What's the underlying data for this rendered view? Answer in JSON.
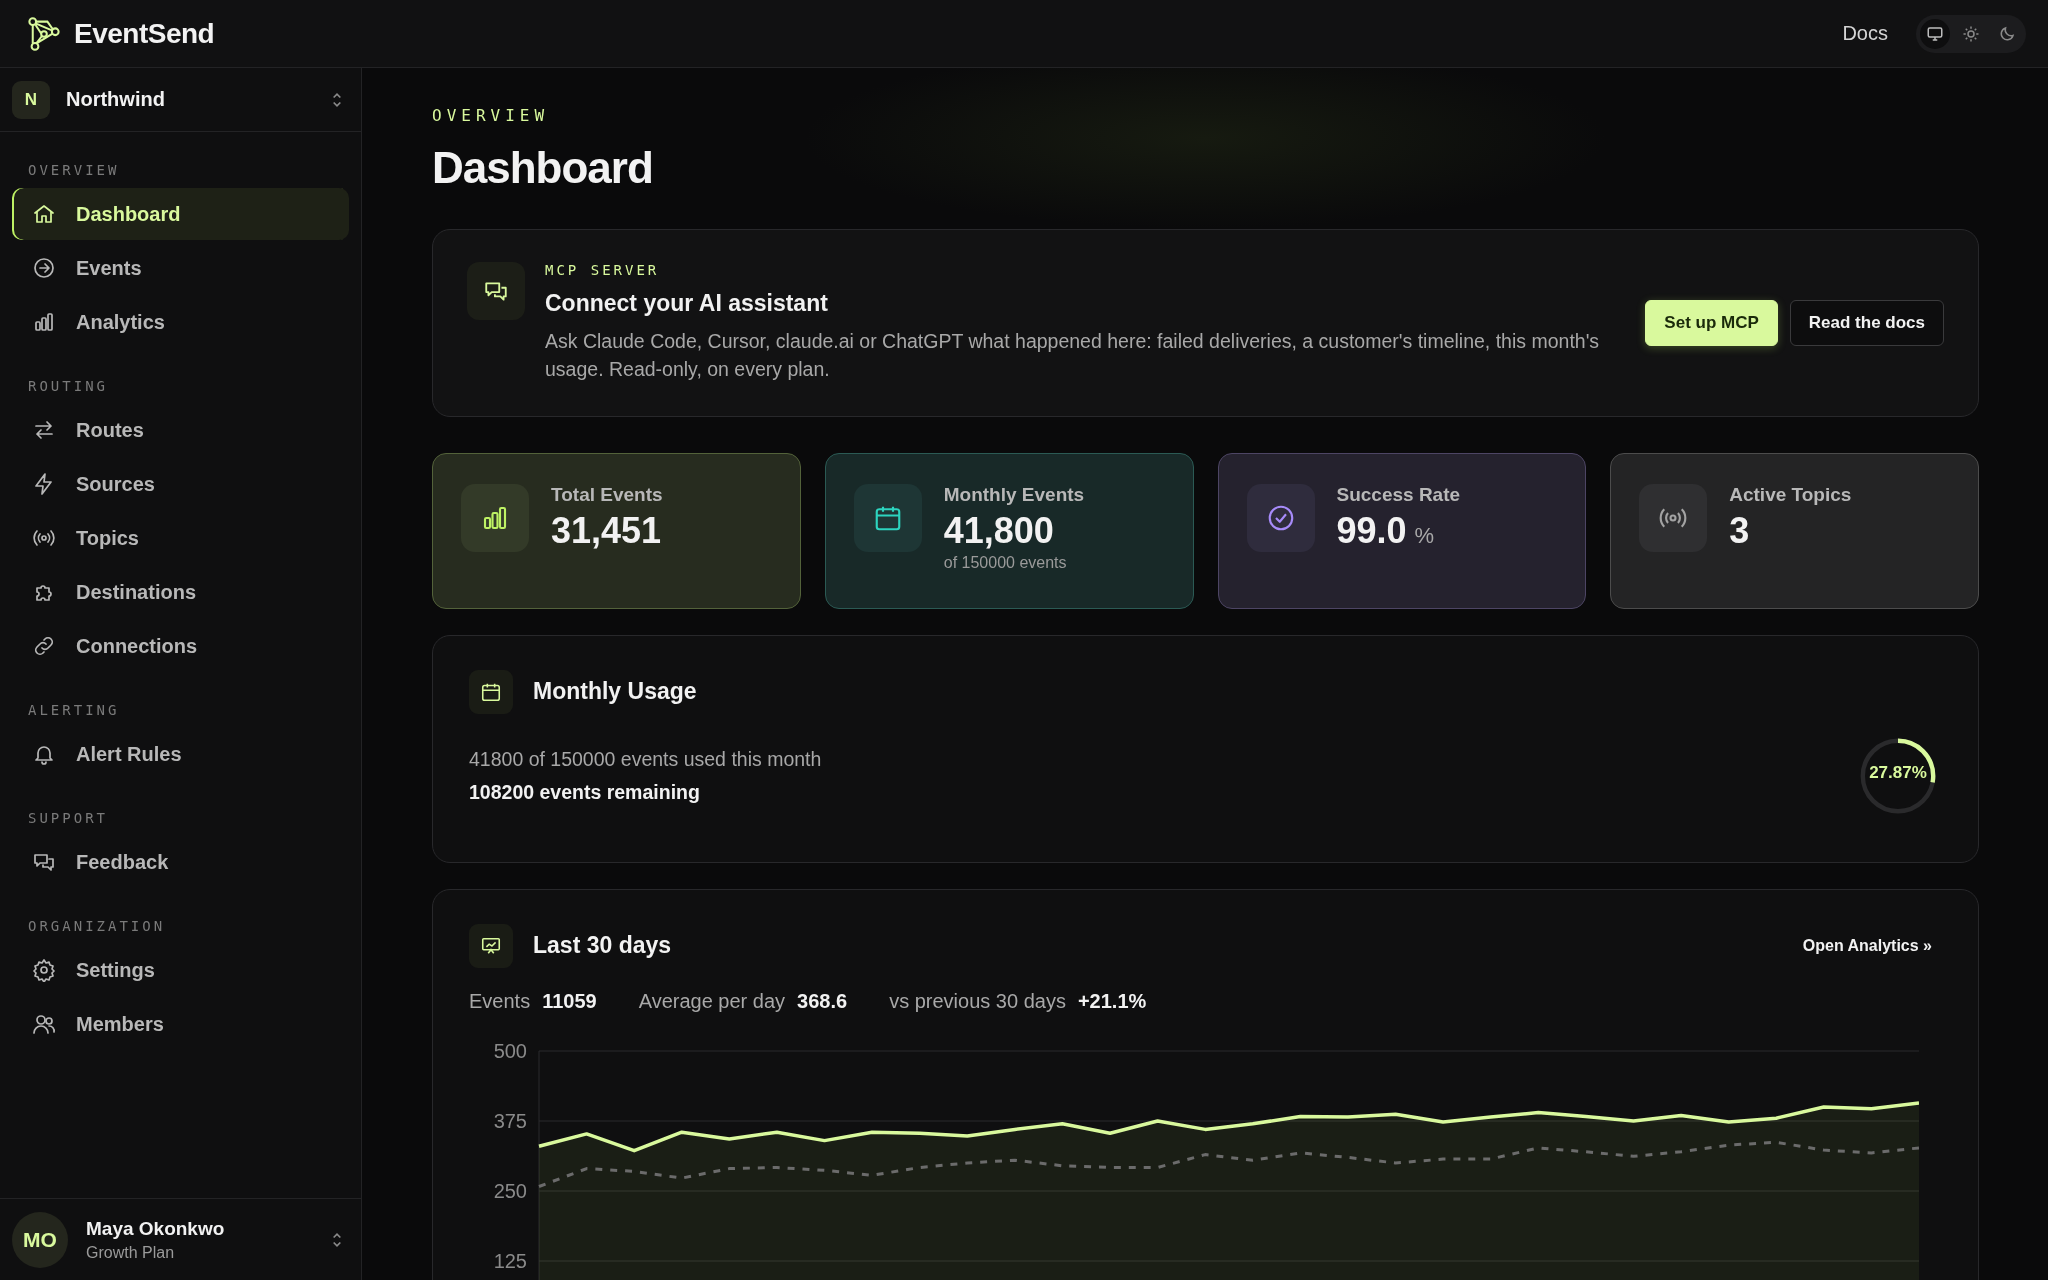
{
  "header": {
    "brand": "EventSend",
    "docs_link": "Docs",
    "theme_options": [
      {
        "kind": "system",
        "selected": true
      },
      {
        "kind": "light",
        "selected": false
      },
      {
        "kind": "dark",
        "selected": false
      }
    ]
  },
  "org_switcher": {
    "initial": "N",
    "name": "Northwind"
  },
  "sidebar": {
    "sections": [
      {
        "title": "OVERVIEW",
        "items": [
          {
            "label": "Dashboard",
            "selected": true
          },
          {
            "label": "Events",
            "selected": false
          },
          {
            "label": "Analytics",
            "selected": false
          }
        ]
      },
      {
        "title": "ROUTING",
        "items": [
          {
            "label": "Routes",
            "selected": false
          },
          {
            "label": "Sources",
            "selected": false
          },
          {
            "label": "Topics",
            "selected": false
          },
          {
            "label": "Destinations",
            "selected": false
          },
          {
            "label": "Connections",
            "selected": false
          }
        ]
      },
      {
        "title": "ALERTING",
        "items": [
          {
            "label": "Alert Rules",
            "selected": false
          }
        ]
      },
      {
        "title": "SUPPORT",
        "items": [
          {
            "label": "Feedback",
            "selected": false
          }
        ]
      },
      {
        "title": "ORGANIZATION",
        "items": [
          {
            "label": "Settings",
            "selected": false
          },
          {
            "label": "Members",
            "selected": false
          }
        ]
      }
    ]
  },
  "user": {
    "initials": "MO",
    "name": "Maya Okonkwo",
    "plan": "Growth Plan"
  },
  "page": {
    "eyebrow": "OVERVIEW",
    "title": "Dashboard"
  },
  "mcp_card": {
    "eyebrow": "MCP SERVER",
    "title": "Connect your AI assistant",
    "description": "Ask Claude Code, Cursor, claude.ai or ChatGPT what happened here: failed deliveries, a customer's timeline, this month's usage. Read-only, on every plan.",
    "buttons": [
      {
        "label": "Set up MCP",
        "kind": "primary"
      },
      {
        "label": "Read the docs",
        "kind": "secondary"
      }
    ]
  },
  "stats": [
    {
      "label": "Total Events",
      "value": "31,451",
      "color": "#bef264"
    },
    {
      "label": "Monthly Events",
      "value": "41,800",
      "sub": "of 150000 events",
      "color": "#2dd4bf"
    },
    {
      "label": "Success Rate",
      "value": "99.0",
      "unit": "%",
      "color": "#a78bfa"
    },
    {
      "label": "Active Topics",
      "value": "3",
      "color": "#a3a3a3"
    }
  ],
  "monthly_usage": {
    "title": "Monthly Usage",
    "used_text": "41800 of 150000 events used this month",
    "remaining_text": "108200 events remaining",
    "level": 0.2787,
    "percent": "27.87%"
  },
  "last_30_days": {
    "title": "Last 30 days",
    "link": "Open Analytics »",
    "metrics": [
      {
        "label": "Events",
        "value": "11059"
      },
      {
        "label": "Average per day",
        "value": "368.6"
      },
      {
        "label": "vs previous 30 days",
        "value": "+21.1%"
      }
    ],
    "chart_data": {
      "type": "line",
      "grid": true,
      "ylim": [
        0,
        500
      ],
      "yticks": [
        125,
        250,
        375,
        500
      ],
      "series": [
        {
          "color": "#d9f99d",
          "line_style": "solid",
          "values": [
            330,
            352,
            322,
            355,
            343,
            355,
            340,
            355,
            353,
            348,
            360,
            370,
            353,
            375,
            360,
            370,
            383,
            382,
            387,
            373,
            382,
            390,
            383,
            375,
            385,
            373,
            380,
            400,
            397,
            407
          ]
        },
        {
          "color": "#6b6b6b",
          "line_style": "dashed",
          "values": [
            258,
            290,
            285,
            273,
            290,
            292,
            287,
            278,
            292,
            300,
            305,
            295,
            292,
            292,
            315,
            305,
            318,
            310,
            300,
            307,
            307,
            327,
            320,
            312,
            320,
            332,
            337,
            323,
            318,
            327
          ]
        }
      ]
    }
  }
}
